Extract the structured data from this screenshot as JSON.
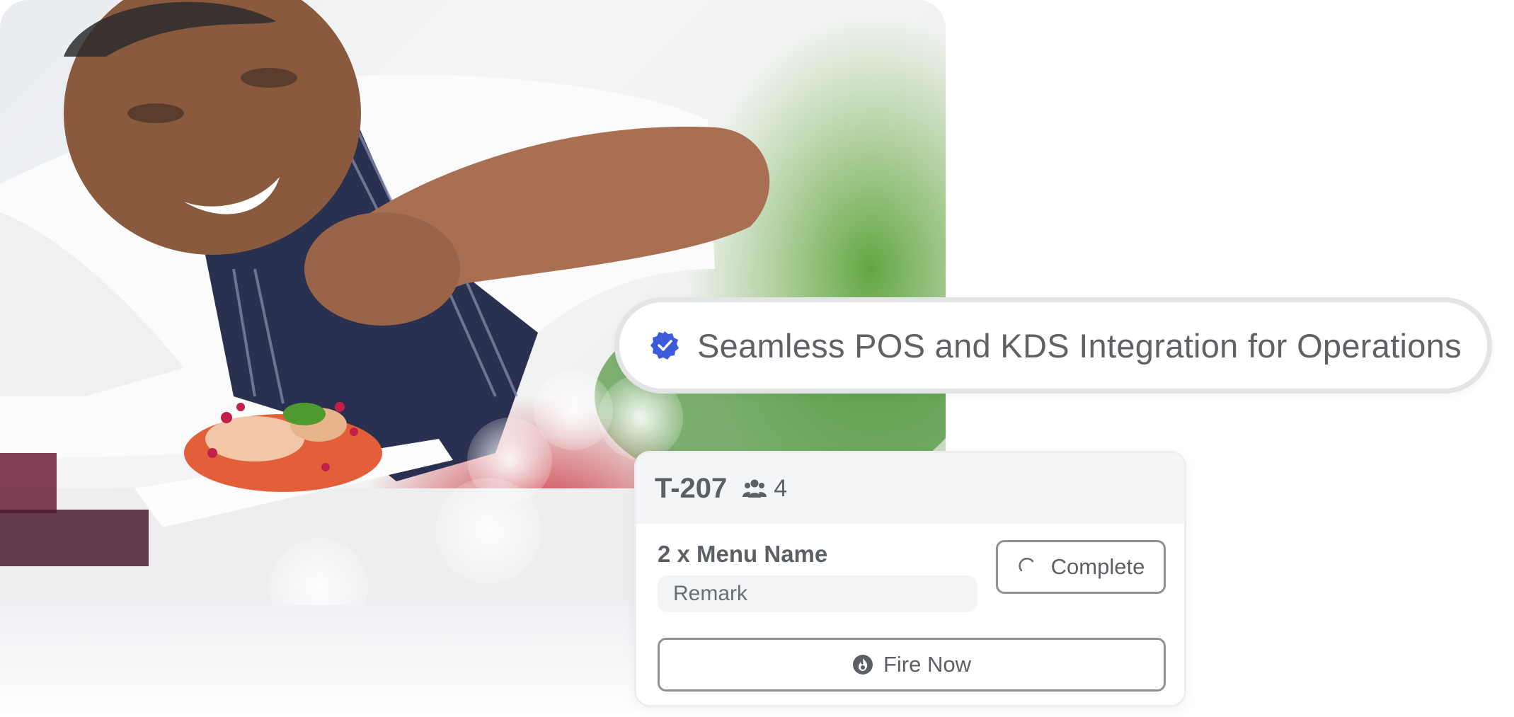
{
  "banner": {
    "text": "Seamless POS and KDS Integration for Operations",
    "icon": "verified-badge-icon",
    "accent_color": "#3b5bdb"
  },
  "order_card": {
    "table_id": "T-207",
    "guests_icon": "people-icon",
    "guests": "4",
    "item": "2 x Menu Name",
    "remark": "Remark",
    "complete_label": "Complete",
    "complete_icon": "loading-spinner-icon",
    "fire_label": "Fire Now",
    "fire_icon": "fire-icon"
  },
  "photo": {
    "subject": "chef-plating-dish-icon"
  }
}
